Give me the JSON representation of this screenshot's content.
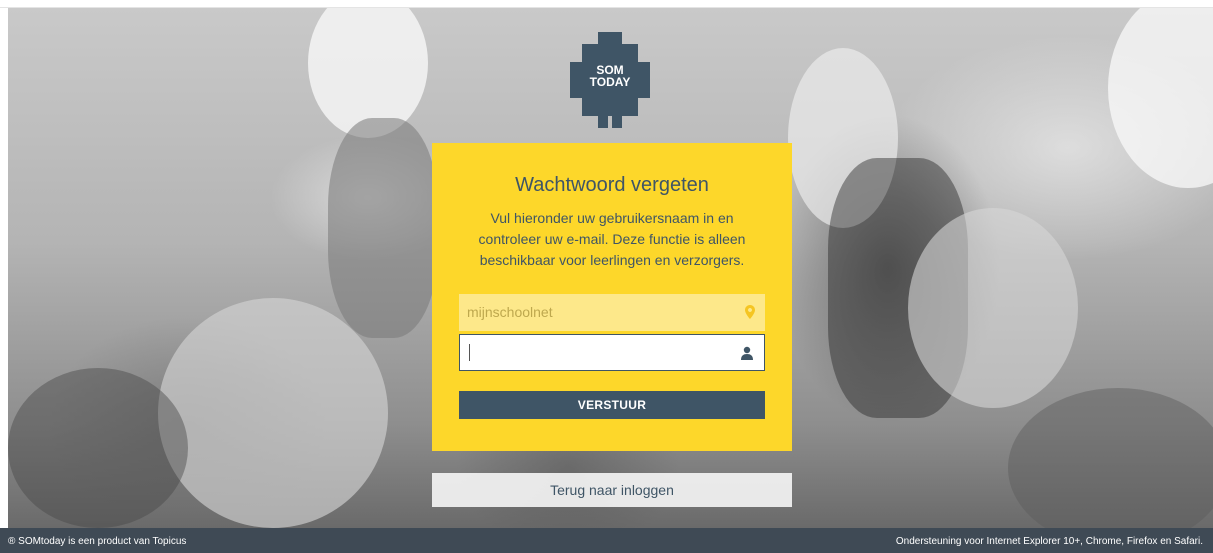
{
  "logo": {
    "line1": "SOM",
    "line2": "TODAY",
    "color": "#3f5566"
  },
  "card": {
    "title": "Wachtwoord vergeten",
    "description": "Vul hieronder uw gebruikersnaam in en controleer uw e-mail. Deze functie is alleen beschikbaar voor leerlingen en verzorgers.",
    "background": "#fdd72a"
  },
  "form": {
    "school_value": "mijnschoolnet",
    "school_icon": "map-marker-icon",
    "username_value": "",
    "username_icon": "user-icon",
    "submit_label": "VERSTUUR"
  },
  "back_link": {
    "label": "Terug naar inloggen"
  },
  "footer": {
    "left": "® SOMtoday is een product van Topicus",
    "right": "Ondersteuning voor Internet Explorer 10+, Chrome, Firefox en Safari."
  }
}
